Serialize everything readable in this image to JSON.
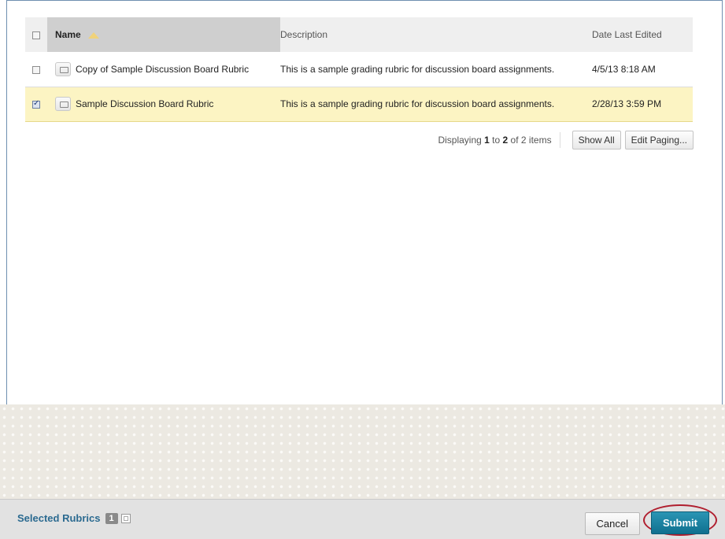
{
  "table": {
    "headers": {
      "name": "Name",
      "description": "Description",
      "date": "Date Last Edited"
    },
    "rows": [
      {
        "name": "Copy of Sample Discussion Board Rubric",
        "description": "This is a sample grading rubric for discussion board assignments.",
        "date": "4/5/13 8:18 AM",
        "checked": false
      },
      {
        "name": "Sample Discussion Board Rubric",
        "description": "This is a sample grading rubric for discussion board assignments.",
        "date": "2/28/13 3:59 PM",
        "checked": true
      }
    ]
  },
  "paging": {
    "prefix": "Displaying ",
    "from": "1",
    "middle": " to ",
    "to": "2",
    "suffix": " of 2 items",
    "show_all": "Show All",
    "edit_paging": "Edit Paging..."
  },
  "footer": {
    "selected_label": "Selected Rubrics",
    "selected_count": "1",
    "cancel": "Cancel",
    "submit": "Submit"
  },
  "colors": {
    "selected_row": "#fcf4c3",
    "submit_button": "#1a7f9e",
    "highlight_circle": "#b01e2e"
  }
}
